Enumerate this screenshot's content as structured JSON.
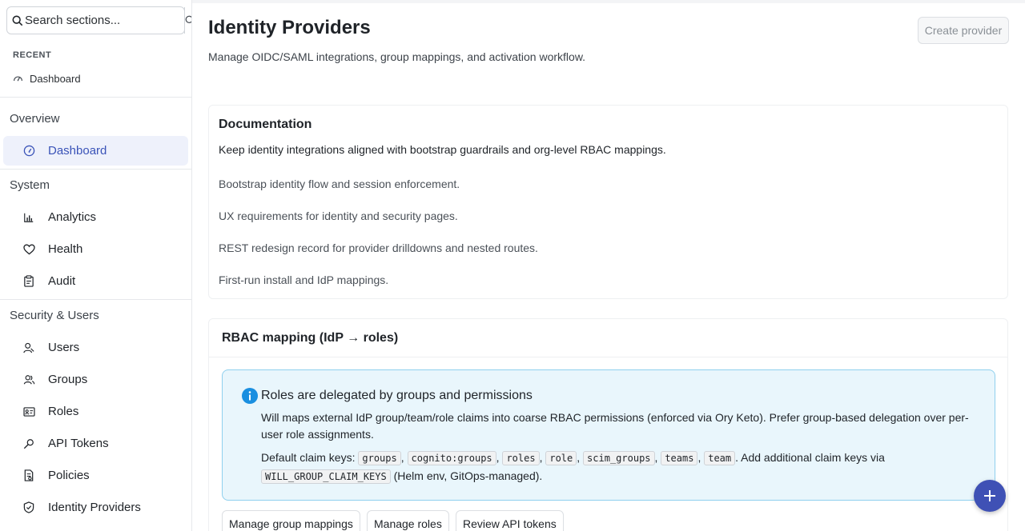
{
  "sidebar": {
    "search": {
      "placeholder": "Search sections..."
    },
    "recent": {
      "label": "RECENT",
      "items": [
        {
          "label": "Dashboard",
          "icon": "dashboard-icon"
        }
      ]
    },
    "sections": [
      {
        "title": "Overview",
        "items": [
          {
            "label": "Dashboard",
            "icon": "dashboard-icon",
            "active": true
          }
        ]
      },
      {
        "title": "System",
        "items": [
          {
            "label": "Analytics",
            "icon": "bar-chart-icon"
          },
          {
            "label": "Health",
            "icon": "heart-icon"
          },
          {
            "label": "Audit",
            "icon": "clipboard-icon"
          }
        ]
      },
      {
        "title": "Security & Users",
        "items": [
          {
            "label": "Users",
            "icon": "user-icon"
          },
          {
            "label": "Groups",
            "icon": "users-icon"
          },
          {
            "label": "Roles",
            "icon": "id-card-icon"
          },
          {
            "label": "API Tokens",
            "icon": "key-icon"
          },
          {
            "label": "Policies",
            "icon": "policy-icon"
          },
          {
            "label": "Identity Providers",
            "icon": "shield-icon"
          }
        ]
      }
    ]
  },
  "header": {
    "title": "Identity Providers",
    "subtitle": "Manage OIDC/SAML integrations, group mappings, and activation workflow.",
    "create_label": "Create provider"
  },
  "documentation": {
    "title": "Documentation",
    "description": "Keep identity integrations aligned with bootstrap guardrails and org-level RBAC mappings.",
    "links": [
      "Bootstrap identity flow and session enforcement.",
      "UX requirements for identity and security pages.",
      "REST redesign record for provider drilldowns and nested routes.",
      "First-run install and IdP mappings."
    ]
  },
  "rbac": {
    "title": "RBAC mapping (IdP → roles)",
    "info": {
      "title": "Roles are delegated by groups and permissions",
      "text": "Will maps external IdP group/team/role claims into coarse RBAC permissions (enforced via Ory Keto). Prefer group-based delegation over per-user role assignments.",
      "claims_prefix": "Default claim keys:",
      "claim_keys": [
        "groups",
        "cognito:groups",
        "roles",
        "role",
        "scim_groups",
        "teams",
        "team"
      ],
      "claims_suffix": ". Add additional claim keys via",
      "env_key": "WILL_GROUP_CLAIM_KEYS",
      "env_suffix": "(Helm env, GitOps-managed)."
    },
    "actions": [
      "Manage group mappings",
      "Manage roles",
      "Review API tokens"
    ]
  },
  "colors": {
    "accent": "#3f51b5",
    "active_bg": "#eef1fb",
    "info_bg": "#e9f6fc",
    "info_border": "#8fd0ee",
    "info_icon": "#1a8fe0"
  }
}
